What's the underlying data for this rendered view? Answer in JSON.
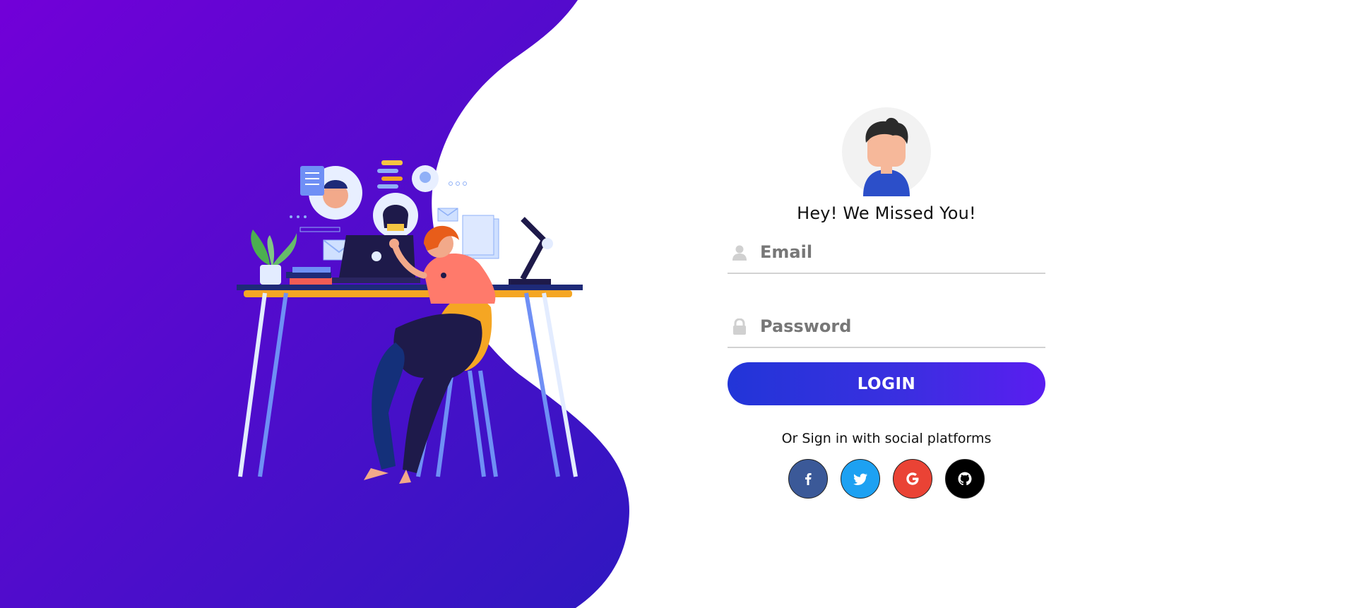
{
  "login": {
    "greeting": "Hey! We Missed You!",
    "email_placeholder": "Email",
    "password_placeholder": "Password",
    "login_label": "LOGIN",
    "social_text": "Or Sign in with social platforms"
  },
  "social": [
    {
      "name": "facebook",
      "icon": "facebook-icon",
      "color": "#3b5998"
    },
    {
      "name": "twitter",
      "icon": "twitter-icon",
      "color": "#1da1f2"
    },
    {
      "name": "google",
      "icon": "google-icon",
      "color": "#ea4335"
    },
    {
      "name": "github",
      "icon": "github-icon",
      "color": "#000000"
    }
  ],
  "colors": {
    "brand_purple": "#6a00d8",
    "brand_blue": "#2c1ac8",
    "accent_button": "#3a2fe0"
  }
}
